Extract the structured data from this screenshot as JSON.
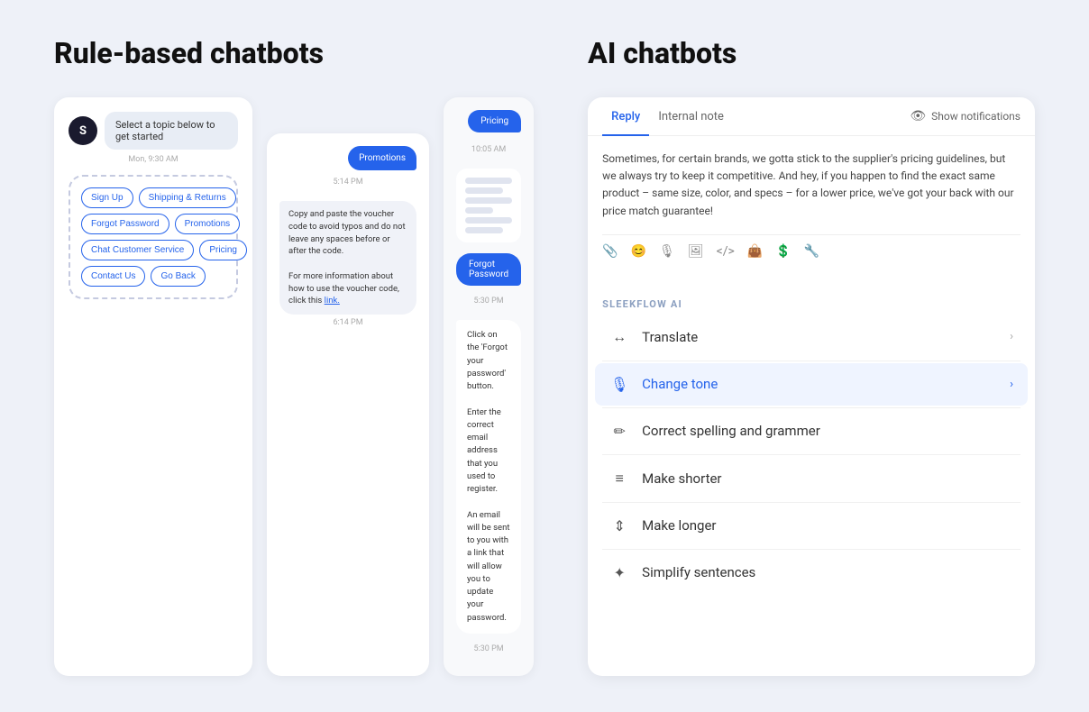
{
  "left": {
    "title": "Rule-based chatbots",
    "panel1": {
      "avatar": "S",
      "prompt": "Select a topic below to get started",
      "timestamp": "Mon, 9:30 AM",
      "buttons_row1": [
        "Sign Up",
        "Shipping & Returns"
      ],
      "buttons_row2": [
        "Forgot Password",
        "Promotions"
      ],
      "buttons_row3": [
        "Chat Customer Service",
        "Pricing"
      ],
      "buttons_row4": [
        "Contact Us",
        "Go Back"
      ]
    },
    "panel2": {
      "bubble_right": "Promotions",
      "time1": "5:14 PM",
      "bubble_left": "Copy and paste the voucher code to avoid typos and do not leave any spaces before or after the code.\n\nFor more information about how to use the voucher code, click this link.",
      "link_text": "link.",
      "time2": "6:14 PM"
    },
    "panel3": {
      "bubble_pricing": "Pricing",
      "time1": "10:05 AM",
      "bubble_forgot": "Forgot Password",
      "time2": "5:30 PM",
      "bubble_answer": "Click on the 'Forgot your password' button.\n\nEnter the correct email address that you used to register.\n\nAn email will be sent to you with a link that will allow you to update your password.",
      "time3": "5:30 PM"
    }
  },
  "right": {
    "title": "AI chatbots",
    "tabs": [
      {
        "label": "Reply",
        "active": true
      },
      {
        "label": "Internal note",
        "active": false
      }
    ],
    "show_notifications": "Show notifications",
    "text_content": "Sometimes, for certain brands, we gotta stick to the supplier's pricing guidelines, but we always try to keep it competitive. And hey, if you happen to find the exact same product – same size, color, and specs – for a lower price, we've got your back with our price match guarantee!",
    "ai_label": "SLEEKFLOW AI",
    "options": [
      {
        "icon": "↔",
        "label": "Translate",
        "active": false,
        "arrow": true
      },
      {
        "icon": "🎙",
        "label": "Change tone",
        "active": true,
        "arrow": true
      },
      {
        "icon": "✏",
        "label": "Correct spelling and grammer",
        "active": false,
        "arrow": false
      },
      {
        "icon": "≡",
        "label": "Make shorter",
        "active": false,
        "arrow": false
      },
      {
        "icon": "↨",
        "label": "Make longer",
        "active": false,
        "arrow": false
      },
      {
        "icon": "✦",
        "label": "Simplify sentences",
        "active": false,
        "arrow": false
      }
    ]
  }
}
